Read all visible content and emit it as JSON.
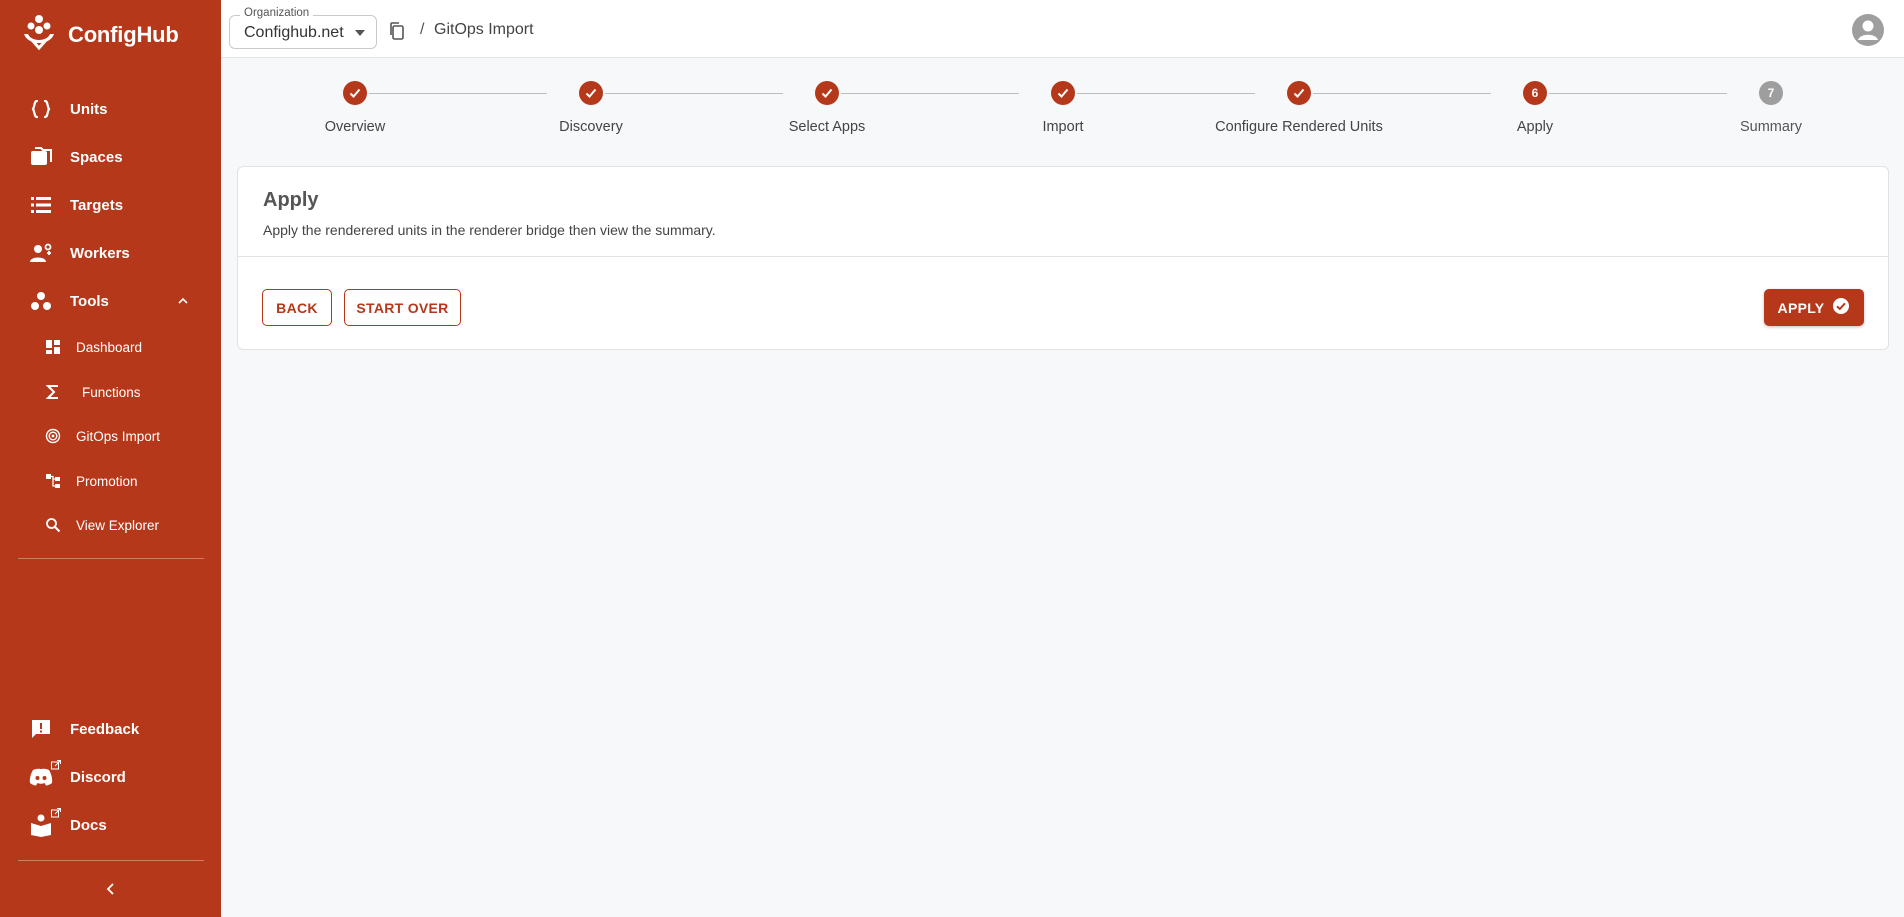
{
  "brand": {
    "name": "ConfigHub"
  },
  "colors": {
    "accent": "#b5381a",
    "step_todo": "#9e9e9e"
  },
  "sidebar": {
    "items": [
      {
        "label": "Units",
        "icon": "braces-icon"
      },
      {
        "label": "Spaces",
        "icon": "folders-icon"
      },
      {
        "label": "Targets",
        "icon": "list-icon"
      },
      {
        "label": "Workers",
        "icon": "workers-icon"
      },
      {
        "label": "Tools",
        "icon": "tools-icon",
        "expanded": true
      }
    ],
    "subitems": [
      {
        "label": "Dashboard",
        "icon": "dashboard-icon"
      },
      {
        "label": "Functions",
        "icon": "sigma-icon"
      },
      {
        "label": "GitOps Import",
        "icon": "target-icon"
      },
      {
        "label": "Promotion",
        "icon": "promotion-icon"
      },
      {
        "label": "View Explorer",
        "icon": "search-icon"
      }
    ],
    "bottom": [
      {
        "label": "Feedback",
        "icon": "feedback-icon"
      },
      {
        "label": "Discord",
        "icon": "discord-icon",
        "external": true
      },
      {
        "label": "Docs",
        "icon": "docs-icon",
        "external": true
      }
    ]
  },
  "topbar": {
    "org_label": "Organization",
    "org_value": "Confighub.net",
    "separator": "/",
    "breadcrumb": "GitOps Import"
  },
  "stepper": {
    "steps": [
      {
        "label": "Overview",
        "state": "done"
      },
      {
        "label": "Discovery",
        "state": "done"
      },
      {
        "label": "Select Apps",
        "state": "done"
      },
      {
        "label": "Import",
        "state": "done"
      },
      {
        "label": "Configure Rendered Units",
        "state": "done"
      },
      {
        "label": "Apply",
        "state": "active",
        "number": "6"
      },
      {
        "label": "Summary",
        "state": "todo",
        "number": "7"
      }
    ]
  },
  "card": {
    "title": "Apply",
    "description": "Apply the renderered units in the renderer bridge then view the summary.",
    "back_label": "BACK",
    "start_over_label": "START OVER",
    "apply_label": "APPLY"
  }
}
